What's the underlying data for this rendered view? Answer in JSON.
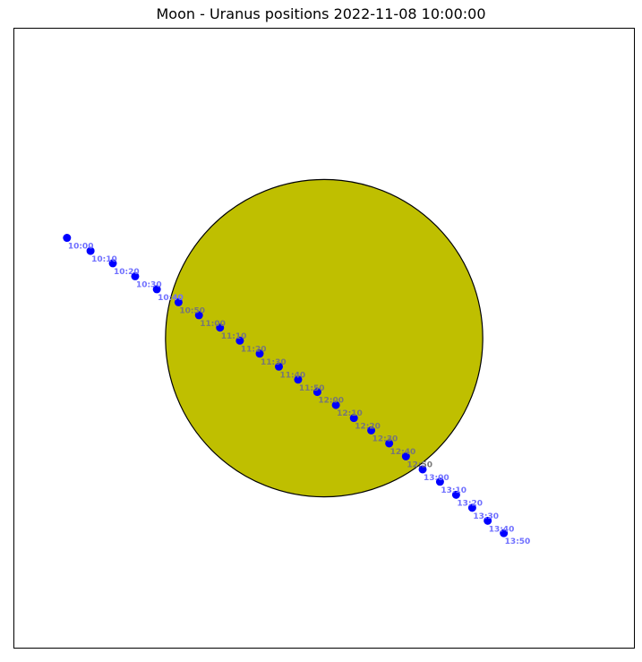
{
  "chart_data": {
    "type": "scatter",
    "title": "Moon - Uranus positions 2022-11-08 10:00:00",
    "xlabel": "",
    "ylabel": "",
    "xlim": [
      0,
      100
    ],
    "ylim": [
      0,
      100
    ],
    "axes_visible": false,
    "grid": false,
    "moon": {
      "center": [
        50,
        50
      ],
      "radius": 25.6,
      "fill_color": "#bfbf00",
      "edge_color": "#000000"
    },
    "series": [
      {
        "marker_color": "#0000ff",
        "label_color_outside": "#7070ff",
        "label_color_inside": "#777777",
        "points": [
          {
            "time": "10:00",
            "x": 8.5,
            "y": 66.2
          },
          {
            "time": "10:10",
            "x": 12.3,
            "y": 64.1
          },
          {
            "time": "10:20",
            "x": 15.9,
            "y": 62.1
          },
          {
            "time": "10:30",
            "x": 19.5,
            "y": 60.0
          },
          {
            "time": "10:40",
            "x": 23.0,
            "y": 57.9
          },
          {
            "time": "10:50",
            "x": 26.5,
            "y": 55.8
          },
          {
            "time": "11:00",
            "x": 29.8,
            "y": 53.7
          },
          {
            "time": "11:10",
            "x": 33.2,
            "y": 51.7
          },
          {
            "time": "11:20",
            "x": 36.4,
            "y": 49.6
          },
          {
            "time": "11:30",
            "x": 39.6,
            "y": 47.5
          },
          {
            "time": "11:40",
            "x": 42.7,
            "y": 45.4
          },
          {
            "time": "11:50",
            "x": 45.8,
            "y": 43.3
          },
          {
            "time": "12:00",
            "x": 48.9,
            "y": 41.3
          },
          {
            "time": "12:10",
            "x": 51.9,
            "y": 39.2
          },
          {
            "time": "12:20",
            "x": 54.8,
            "y": 37.1
          },
          {
            "time": "12:30",
            "x": 57.6,
            "y": 35.1
          },
          {
            "time": "12:40",
            "x": 60.5,
            "y": 33.0
          },
          {
            "time": "12:50",
            "x": 63.2,
            "y": 30.9
          },
          {
            "time": "13:00",
            "x": 65.9,
            "y": 28.8
          },
          {
            "time": "13:10",
            "x": 68.7,
            "y": 26.8
          },
          {
            "time": "13:20",
            "x": 71.3,
            "y": 24.7
          },
          {
            "time": "13:30",
            "x": 73.9,
            "y": 22.6
          },
          {
            "time": "13:40",
            "x": 76.4,
            "y": 20.5
          },
          {
            "time": "13:50",
            "x": 79.0,
            "y": 18.5
          }
        ]
      }
    ]
  }
}
